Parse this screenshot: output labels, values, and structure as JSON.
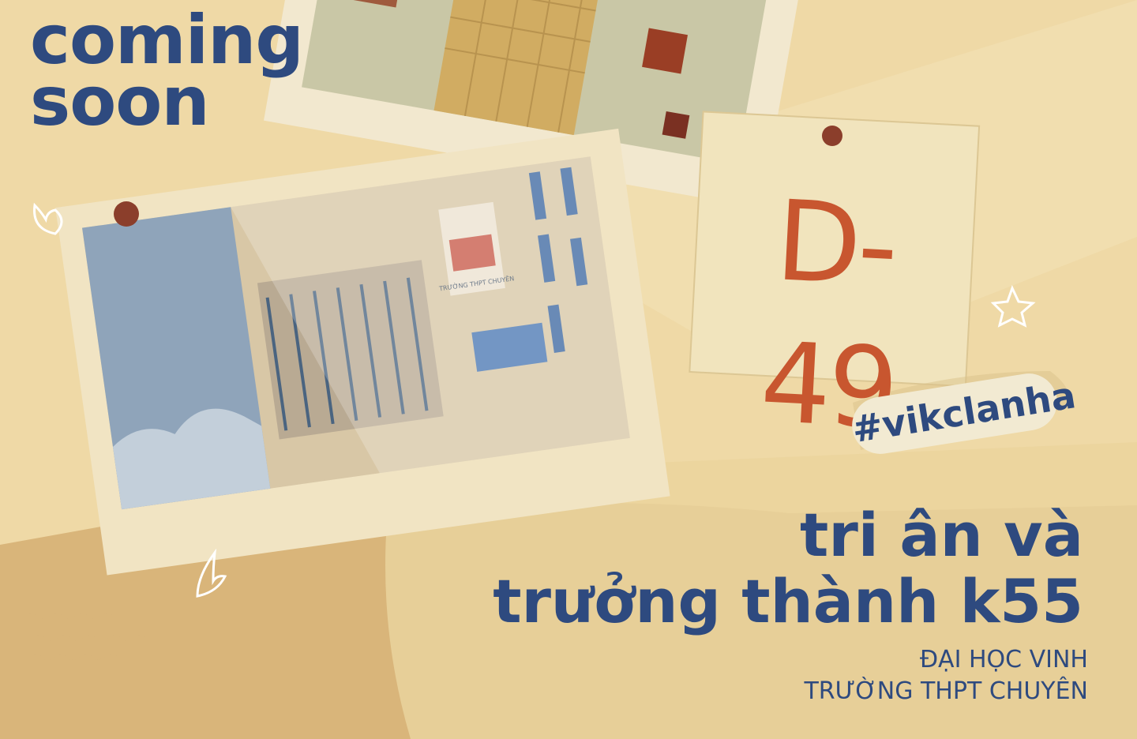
{
  "header": {
    "coming_line1": "coming",
    "coming_line2": "soon"
  },
  "note": {
    "countdown": "D-49"
  },
  "hashtag": "#vikclanha",
  "headline": {
    "line1": "tri ân và",
    "line2": "trưởng thành k55"
  },
  "subtitle": {
    "line1": "ĐẠI HỌC VINH",
    "line2": "TRƯỜNG THPT CHUYÊN"
  },
  "photo": {
    "sign_text": "TRƯỜNG THPT CHUYÊN"
  },
  "colors": {
    "background": "#efd9a6",
    "text_blue": "#2e4a7f",
    "pin": "#8b3e2b",
    "note_ink": "#c8562f"
  }
}
